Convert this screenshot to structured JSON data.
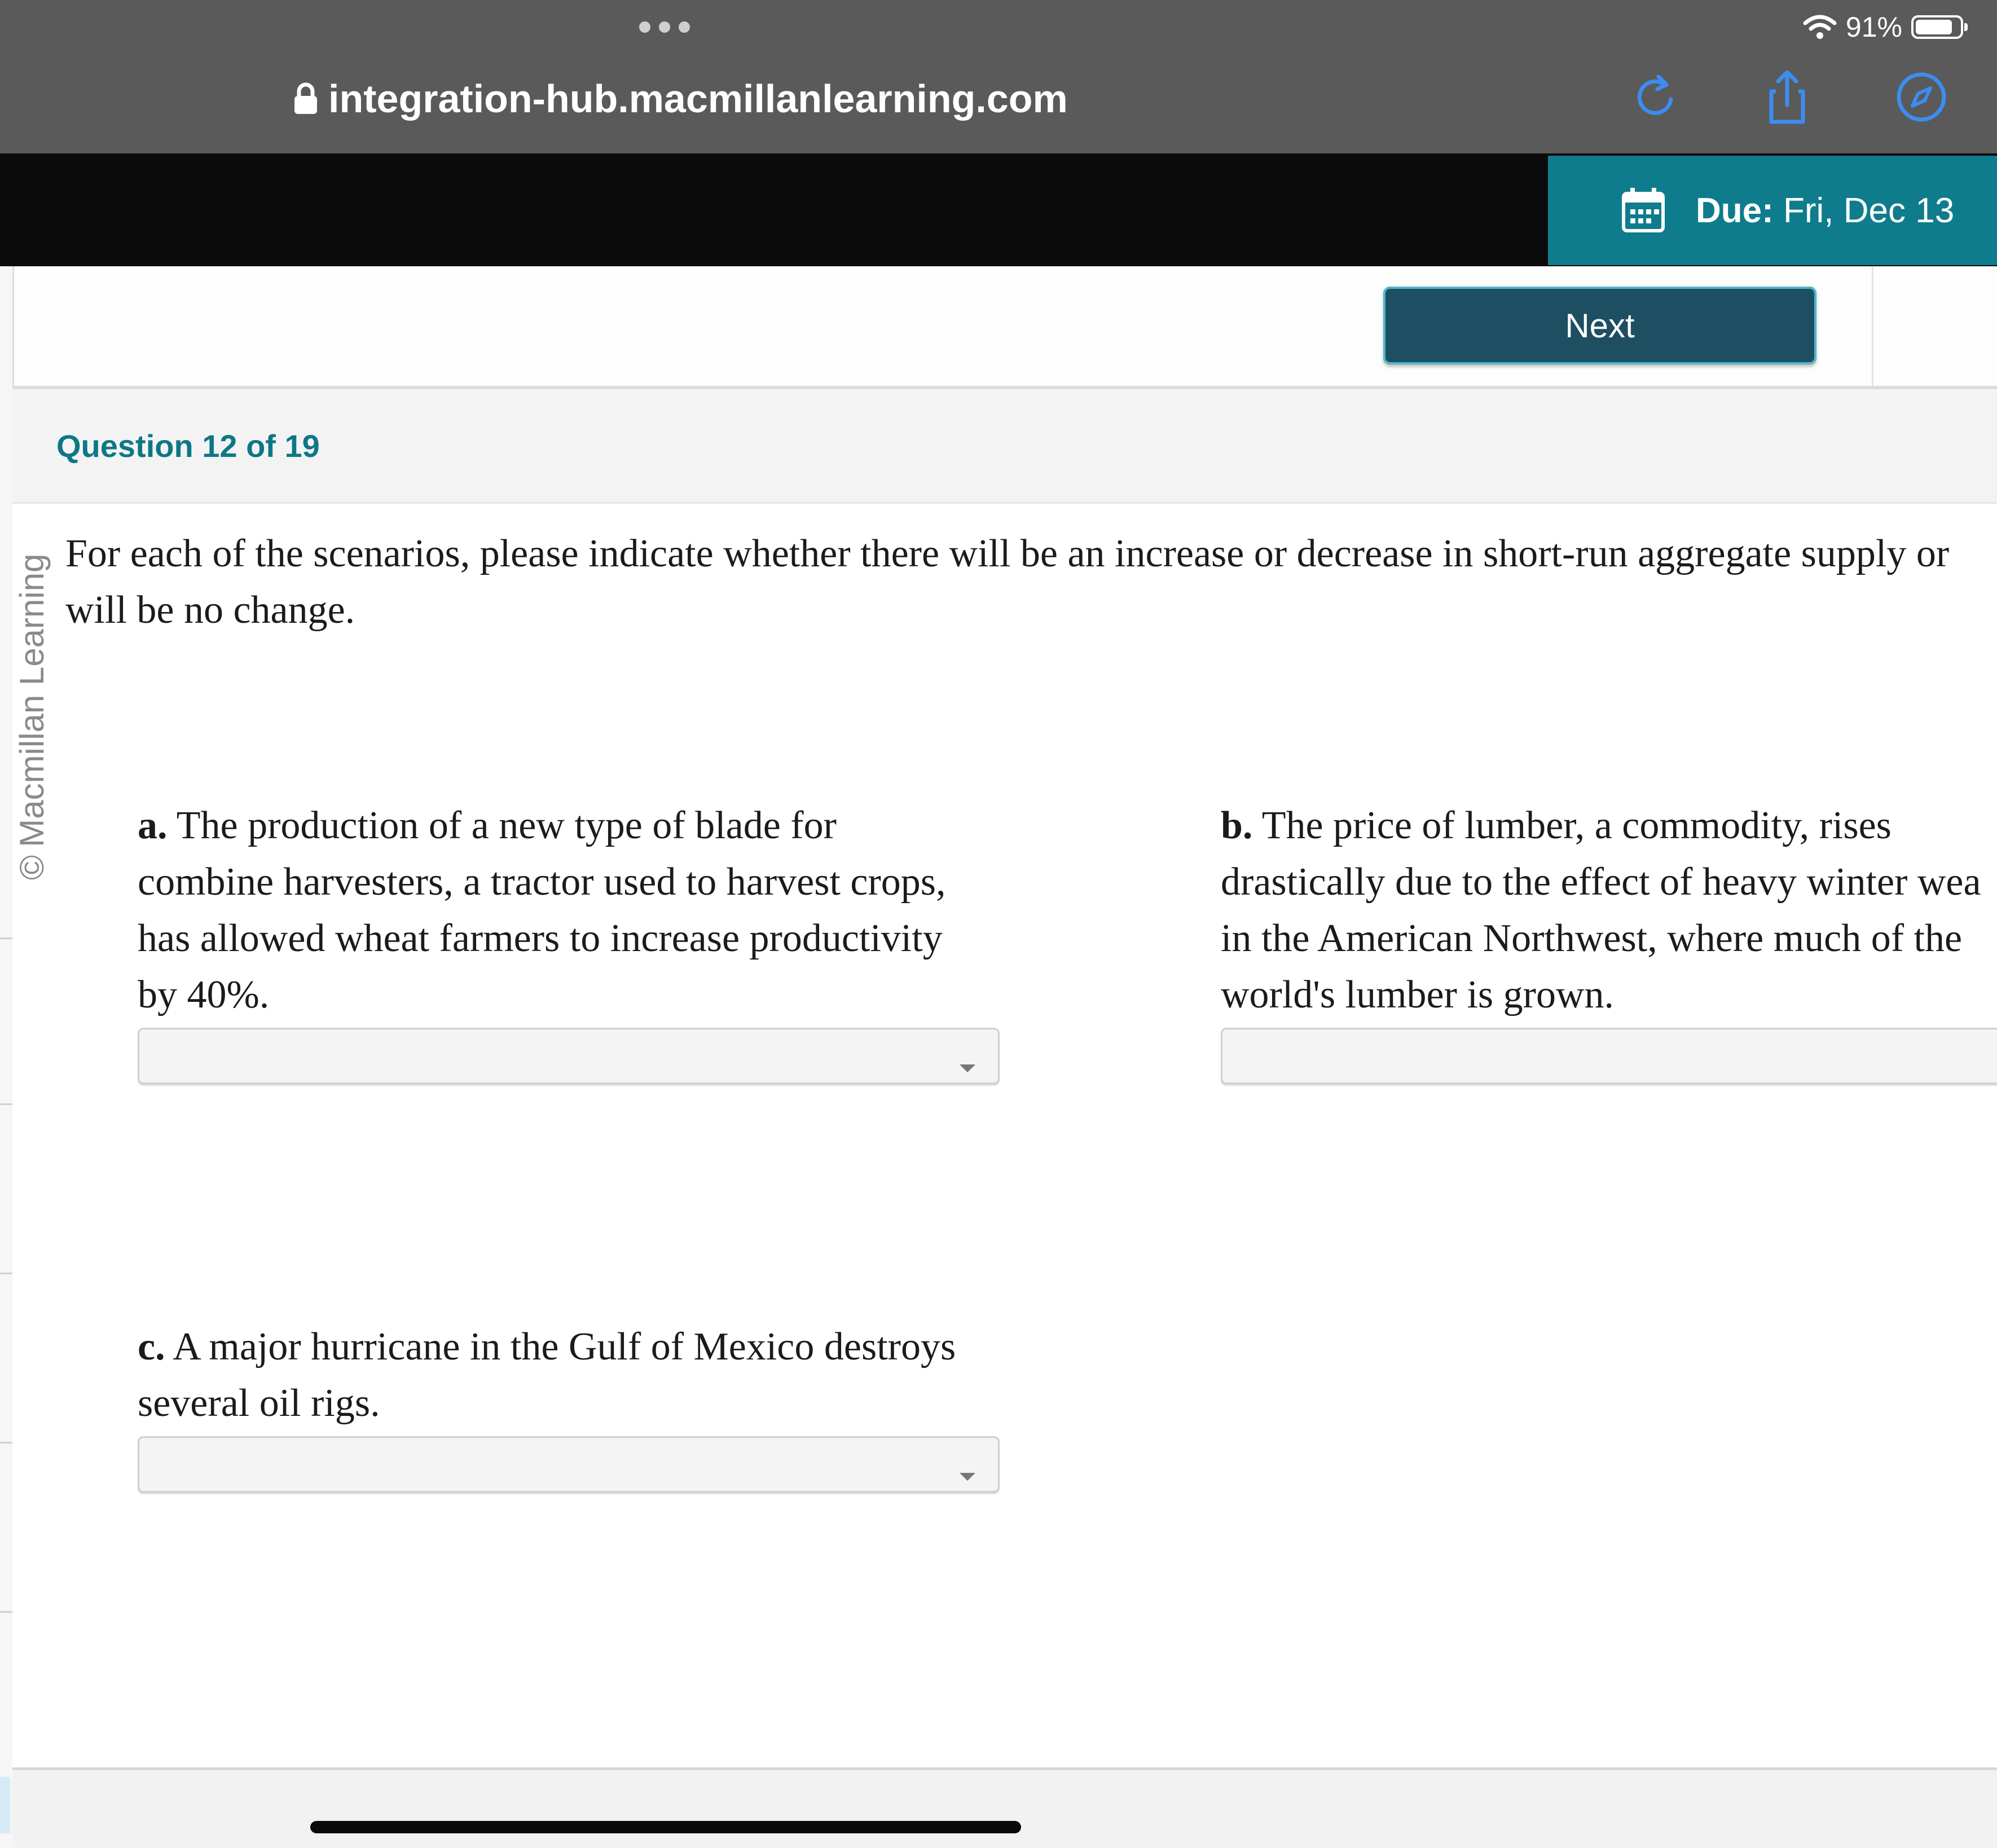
{
  "browser": {
    "url": "integration-hub.macmillanlearning.com",
    "battery": "91%"
  },
  "header": {
    "due_label": "Due:",
    "due_value": "Fri, Dec 13"
  },
  "toolbar": {
    "next_label": "Next"
  },
  "question": {
    "title": "Question 12 of 19",
    "prompt_line1": "For each of the scenarios, please indicate whether there will be an increase or decrease in short-run aggregate supply or",
    "prompt_line2": "will be no change."
  },
  "credit": "Macmillan Learning",
  "parts": {
    "a": {
      "marker": "a.",
      "lines": [
        "The production of a new type of blade for",
        "combine harvesters, a tractor used to harvest crops,",
        "has allowed wheat farmers to increase productivity",
        "by 40%."
      ],
      "selected": ""
    },
    "b": {
      "marker": "b.",
      "lines": [
        "The price of lumber, a commodity, rises",
        "drastically due to the effect of heavy winter wea",
        "in the American Northwest, where much of the",
        "world's lumber is grown."
      ],
      "selected": ""
    },
    "c": {
      "marker": "c.",
      "lines": [
        "A major hurricane in the Gulf of Mexico destroys",
        "several oil rigs."
      ],
      "selected": ""
    }
  },
  "colors": {
    "chrome": "#5a5a5a",
    "header": "#0b0b0c",
    "due_bg": "#0e7c8c",
    "next_bg": "#1d4e61",
    "title": "#0e7785",
    "chrome_icons": "#3c8df0"
  },
  "icons": [
    "lock-icon",
    "reload-icon",
    "share-icon",
    "compass-icon",
    "wifi-icon",
    "battery-icon",
    "calendar-icon",
    "copyright-icon",
    "chevron-down-icon"
  ]
}
